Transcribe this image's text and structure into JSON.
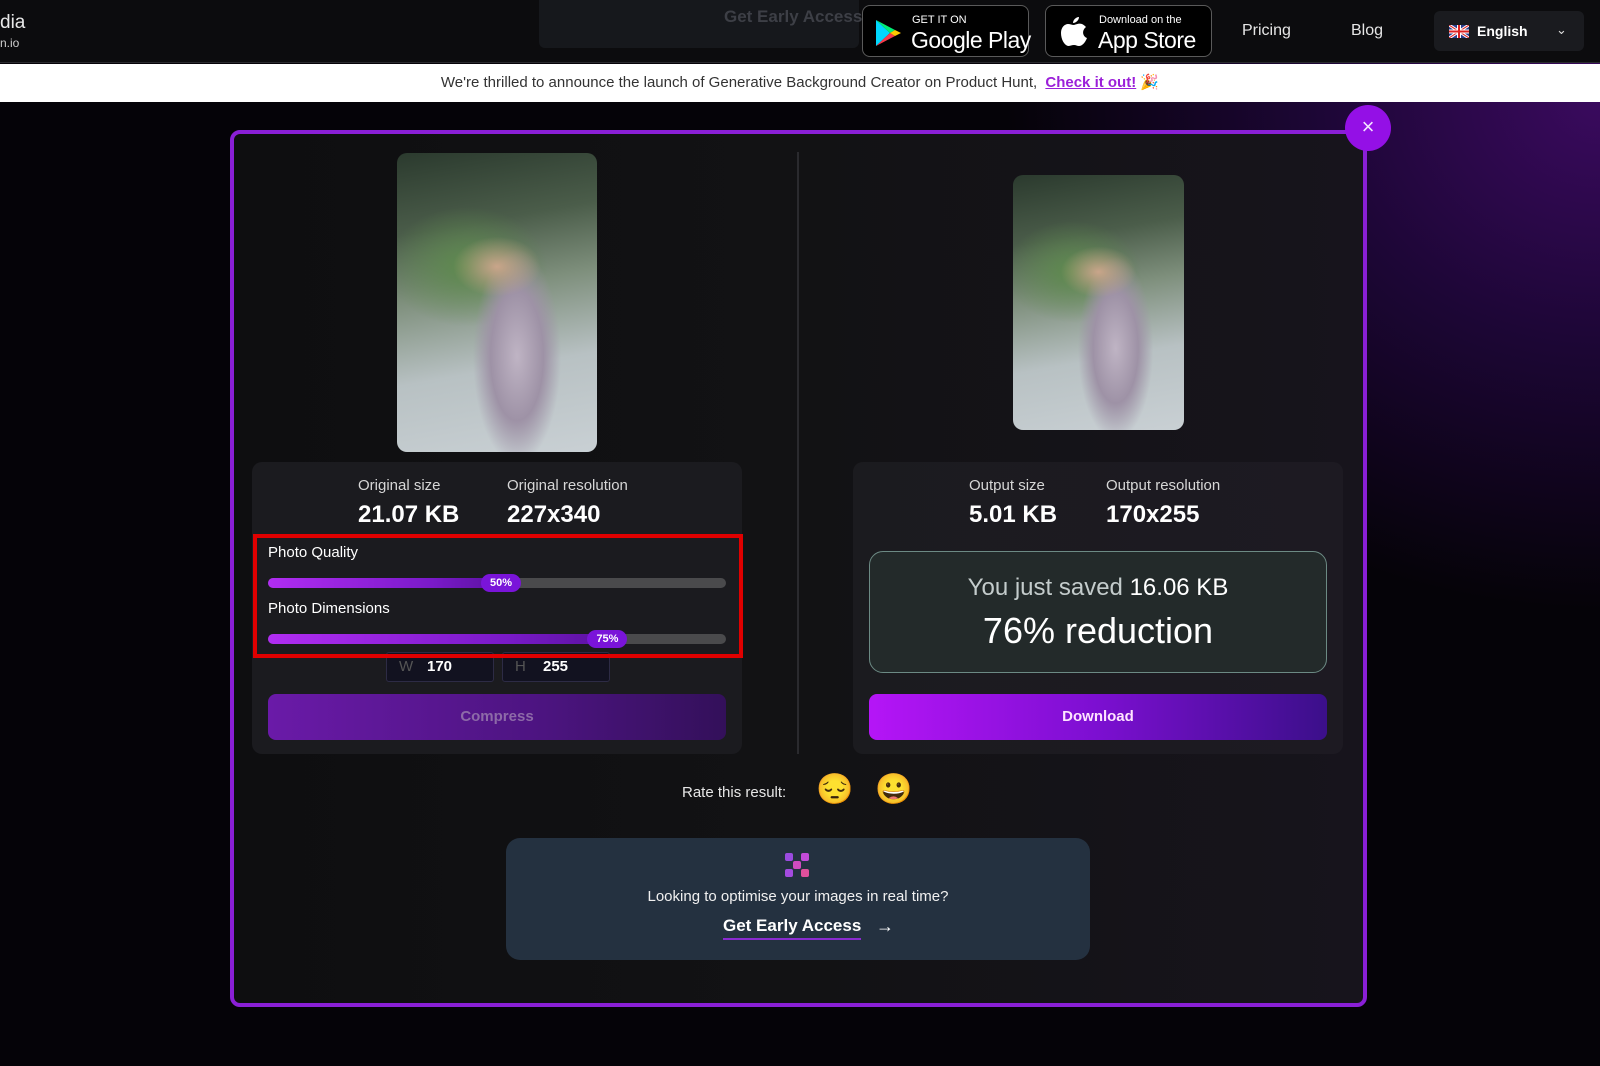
{
  "nav": {
    "logo_main": "dia",
    "logo_sub": "n.io",
    "ghost_cta": "Get Early Access",
    "google_play": {
      "small": "GET IT ON",
      "big": "Google Play"
    },
    "app_store": {
      "small": "Download on the",
      "big": "App Store"
    },
    "links": [
      "Pricing",
      "Blog"
    ],
    "language": "English",
    "icons": {
      "google_play": "google-play-icon",
      "apple": "apple-icon",
      "flag": "uk-flag-icon",
      "chevron": "chevron-down-icon"
    }
  },
  "announcement": {
    "text": "We're thrilled to announce the launch of Generative Background Creator on Product Hunt,",
    "link": "Check it out!",
    "emoji": "🎉"
  },
  "modal": {
    "close_icon": "×",
    "original": {
      "size_label": "Original size",
      "size_value": "21.07 KB",
      "res_label": "Original resolution",
      "res_value": "227x340"
    },
    "sliders": [
      {
        "label": "Photo Quality",
        "value_percent": 50,
        "display": "50%"
      },
      {
        "label": "Photo Dimensions",
        "value_percent": 75,
        "display": "75%"
      }
    ],
    "dimensions": {
      "w_prefix": "W",
      "w_value": "170",
      "h_prefix": "H",
      "h_value": "255"
    },
    "compress_label": "Compress",
    "output": {
      "size_label": "Output size",
      "size_value": "5.01 KB",
      "res_label": "Output resolution",
      "res_value": "170x255"
    },
    "saved": {
      "prefix": "You just saved",
      "amount": "16.06 KB",
      "reduction": "76% reduction"
    },
    "download_label": "Download",
    "rate": {
      "label": "Rate this result:",
      "bad": "😔",
      "good": "😀"
    },
    "promo": {
      "text": "Looking to optimise your images in real time?",
      "link": "Get Early Access",
      "arrow": "→"
    }
  },
  "colors": {
    "accent": "#9410e6",
    "highlight": "#e00000"
  }
}
